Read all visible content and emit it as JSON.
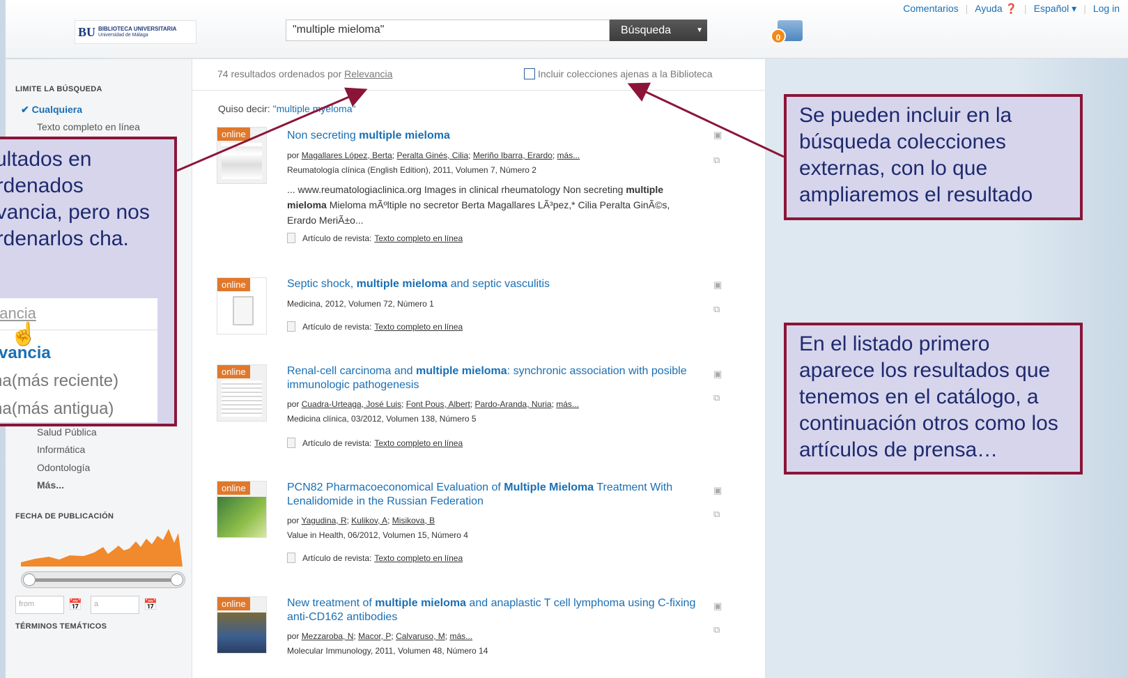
{
  "header": {
    "logo_mark": "BU",
    "logo_line1": "BIBLIOTECA UNIVERSITARIA",
    "logo_line2": "Universidad de Málaga",
    "search_value": "\"multiple mieloma\"",
    "search_button": "Búsqueda",
    "basket_count": "0",
    "links": [
      "Comentarios",
      "Ayuda",
      "Español",
      "Log in"
    ]
  },
  "sidebar": {
    "limit_heading": "LIMITE LA BÚSQUEDA",
    "limit_active": "Cualquiera",
    "limit_items": [
      "Texto completo en línea"
    ],
    "subjects": [
      "Salud Pública",
      "Informática",
      "Odontología",
      "Más..."
    ],
    "date_heading": "FECHA DE PUBLICACIÓN",
    "date_from_placeholder": "from",
    "date_to_placeholder": "a",
    "terms_heading": "TÉRMINOS TEMÁTICOS"
  },
  "results_header": {
    "count_text": "74 resultados ordenados por",
    "sort_link": "Relevancia",
    "include_label": "Incluir colecciones ajenas a la Biblioteca",
    "did_you_mean_label": "Quiso decir:",
    "did_you_mean_value": "\"multiple myeloma\""
  },
  "results": [
    {
      "title_a": "Non secreting ",
      "title_b": "multiple mieloma",
      "title_c": "",
      "authors": [
        "Magallares López, Berta",
        "Peralta Ginés, Cilia",
        "Meriño Ibarra, Erardo",
        "más..."
      ],
      "source": "Reumatología clínica (English Edition), 2011, Volumen 7, Número 2",
      "snippet_a": "... www.reumatologiaclinica.org Images in clinical rheumatology Non secreting ",
      "snippet_b": "multiple mieloma",
      "snippet_c": " Mieloma mÃºltiple no secretor Berta Magallares LÃ³pez,* Cilia Peralta GinÃ©s, Erardo MeriÃ±o...",
      "type": "Artículo de revista:",
      "type_link": "Texto completo en línea"
    },
    {
      "title_a": "Septic shock, ",
      "title_b": "multiple mieloma",
      "title_c": " and septic vasculitis",
      "source": "Medicina, 2012, Volumen 72, Número 1",
      "type": "Artículo de revista:",
      "type_link": "Texto completo en línea"
    },
    {
      "title_a": "Renal-cell carcinoma and ",
      "title_b": "multiple mieloma",
      "title_c": ": synchronic association with posible immunologic pathogenesis",
      "authors": [
        "Cuadra-Urteaga, José Luis",
        "Font Pous, Albert",
        "Pardo-Aranda, Nuria",
        "más..."
      ],
      "source": "Medicina clínica, 03/2012, Volumen 138, Número 5",
      "type": "Artículo de revista:",
      "type_link": "Texto completo en línea"
    },
    {
      "title_a": "PCN82 Pharmacoeconomical Evaluation of ",
      "title_b": "Multiple Mieloma",
      "title_c": " Treatment With Lenalidomide in the Russian Federation",
      "authors": [
        "Yagudina, R",
        "Kulikov, A",
        "Misikova, B"
      ],
      "source": "Value in Health, 06/2012, Volumen 15, Número 4",
      "type": "Artículo de revista:",
      "type_link": "Texto completo en línea"
    },
    {
      "title_a": "New treatment of ",
      "title_b": "multiple mieloma",
      "title_c": " and anaplastic T cell lymphoma using C-fixing anti-CD162 antibodies",
      "authors": [
        "Mezzaroba, N",
        "Macor, P",
        "Calvaruso, M",
        "más..."
      ],
      "source": "Molecular Immunology, 2011, Volumen 48, Número 14"
    }
  ],
  "badge_online": "online",
  "by_label": "por",
  "callouts": {
    "left_text": "sultados en ordenados evancia, pero nos ordenarlos cha.",
    "left_dropdown_current": "evancia",
    "left_dropdown_options": [
      "levancia",
      "cha(más reciente)",
      "cha(más antigua)"
    ],
    "right_top": "Se pueden incluir en la búsqueda colecciones externas, con lo que ampliaremos el resultado",
    "right_bottom": "En el listado primero aparece los resultados que tenemos en el catálogo, a continuación otros como los artículos de prensa…"
  },
  "colors": {
    "accent": "#1a6fb4",
    "callout_border": "#8b1538",
    "callout_bg": "#d7d5ec",
    "online_badge": "#e0782b"
  }
}
